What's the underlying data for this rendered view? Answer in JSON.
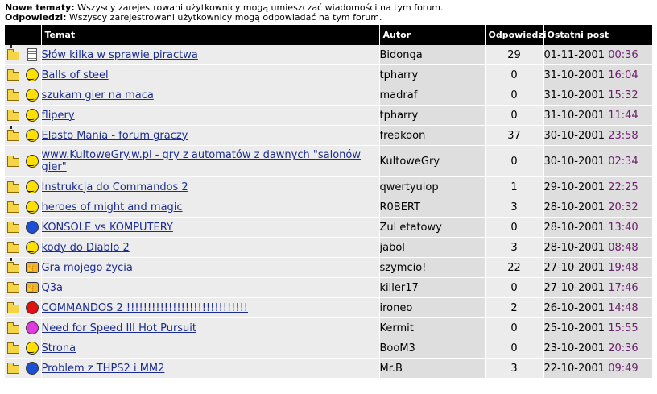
{
  "permissions": {
    "new_topics_label": "Nowe tematy:",
    "new_topics_text": "Wszyscy zarejestrowani użytkownicy mogą umieszczać wiadomości na tym forum.",
    "replies_label": "Odpowiedzi:",
    "replies_text": "Wszyscy zarejestrowani użytkownicy mogą odpowiadać na tym forum."
  },
  "headers": {
    "topic": "Temat",
    "author": "Autor",
    "replies": "Odpowiedzi",
    "last_post": "Ostatni post"
  },
  "rows": [
    {
      "folder": "folder-hot-icon",
      "emoticon": "document-icon",
      "title": "Słów kilka w sprawie piractwa",
      "author": "Bidonga",
      "replies": "29",
      "date": "01-11-2001",
      "time": "00:36"
    },
    {
      "folder": "folder-icon",
      "emoticon": "smile-icon",
      "title": "Balls of steel",
      "author": "tpharry",
      "replies": "0",
      "date": "31-10-2001",
      "time": "16:04"
    },
    {
      "folder": "folder-icon",
      "emoticon": "smile-icon",
      "title": "szukam gier na maca",
      "author": "madraf",
      "replies": "0",
      "date": "31-10-2001",
      "time": "15:32"
    },
    {
      "folder": "folder-icon",
      "emoticon": "smile-icon",
      "title": "flipery",
      "author": "tpharry",
      "replies": "0",
      "date": "31-10-2001",
      "time": "11:44"
    },
    {
      "folder": "folder-hot-icon",
      "emoticon": "smile-icon",
      "title": "Elasto Mania - forum graczy",
      "author": "freakoon",
      "replies": "37",
      "date": "30-10-2001",
      "time": "23:58"
    },
    {
      "folder": "folder-icon",
      "emoticon": "smile-icon",
      "title": "www.KultoweGry.w.pl - gry z automatów z dawnych \"salonów gier\"",
      "author": "KultoweGry",
      "replies": "0",
      "date": "30-10-2001",
      "time": "02:34",
      "tall": true
    },
    {
      "folder": "folder-icon",
      "emoticon": "smile-icon",
      "title": "Instrukcja do Commandos 2",
      "author": "qwertyuiop",
      "replies": "1",
      "date": "29-10-2001",
      "time": "22:25"
    },
    {
      "folder": "folder-icon",
      "emoticon": "smile-icon",
      "title": "heroes of might and magic",
      "author": "R0BERT",
      "replies": "3",
      "date": "28-10-2001",
      "time": "20:32"
    },
    {
      "folder": "folder-icon",
      "emoticon": "question-icon",
      "title": "KONSOLE vs KOMPUTERY",
      "author": "Zul etatowy",
      "replies": "0",
      "date": "28-10-2001",
      "time": "13:40"
    },
    {
      "folder": "folder-icon",
      "emoticon": "smile-icon",
      "title": "kody do Diablo 2",
      "author": "jabol",
      "replies": "3",
      "date": "28-10-2001",
      "time": "08:48"
    },
    {
      "folder": "folder-hot-icon",
      "emoticon": "thumbs-up-icon",
      "title": "Gra mojego życia",
      "author": "szymcio!",
      "replies": "22",
      "date": "27-10-2001",
      "time": "19:48"
    },
    {
      "folder": "folder-icon",
      "emoticon": "thumbs-up-icon",
      "title": "Q3a",
      "author": "killer17",
      "replies": "0",
      "date": "27-10-2001",
      "time": "17:46"
    },
    {
      "folder": "folder-icon",
      "emoticon": "stop-icon",
      "title": "COMMANDOS 2 !!!!!!!!!!!!!!!!!!!!!!!!!!!!!",
      "author": "ironeo",
      "replies": "2",
      "date": "26-10-2001",
      "time": "14:48"
    },
    {
      "folder": "folder-icon",
      "emoticon": "pink-icon",
      "title": "Need for Speed III Hot Pursuit",
      "author": "Kermit",
      "replies": "0",
      "date": "25-10-2001",
      "time": "15:55"
    },
    {
      "folder": "folder-icon",
      "emoticon": "smile-icon",
      "title": "Strona",
      "author": "BooM3",
      "replies": "0",
      "date": "23-10-2001",
      "time": "20:36"
    },
    {
      "folder": "folder-icon",
      "emoticon": "question-icon",
      "title": "Problem z THPS2 i MM2",
      "author": "Mr.B",
      "replies": "3",
      "date": "22-10-2001",
      "time": "09:49"
    }
  ]
}
